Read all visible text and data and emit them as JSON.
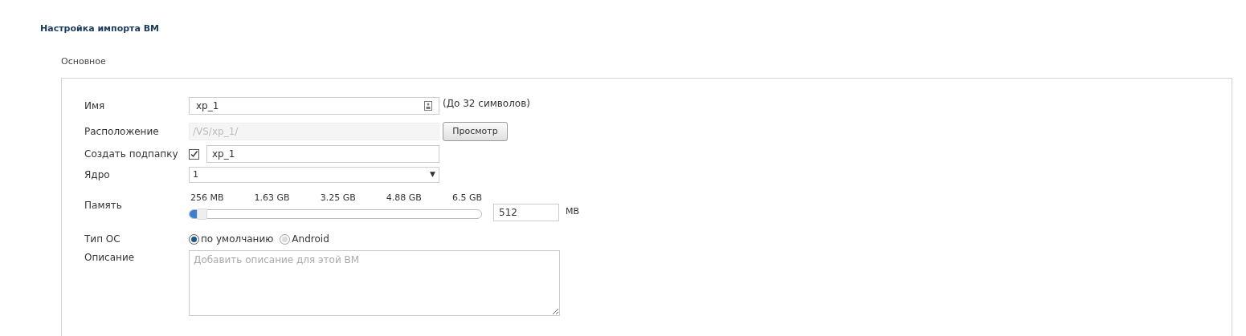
{
  "title": "Настройка импорта ВМ",
  "section": "Основное",
  "name": {
    "label": "Имя",
    "value": "xp_1",
    "hint": "(До 32 символов)"
  },
  "location": {
    "label": "Расположение",
    "value": "/VS/xp_1/",
    "disabled": true,
    "button": "Просмотр"
  },
  "subfolder": {
    "label": "Создать подпапку",
    "checked": true,
    "value": "xp_1"
  },
  "cores": {
    "label": "Ядро",
    "value": "1",
    "caret": "▼"
  },
  "memory": {
    "label": "Память",
    "ticks": [
      "256 MB",
      "1.63 GB",
      "3.25 GB",
      "4.88 GB",
      "6.5 GB"
    ],
    "level": 0.04,
    "value": "512",
    "unit": "MB"
  },
  "os_type": {
    "label": "Тип ОС",
    "options": [
      {
        "label": "по умолчанию",
        "selected": true
      },
      {
        "label": "Android",
        "selected": false
      }
    ]
  },
  "description": {
    "label": "Описание",
    "placeholder": "Добавить описание для этой ВМ"
  }
}
